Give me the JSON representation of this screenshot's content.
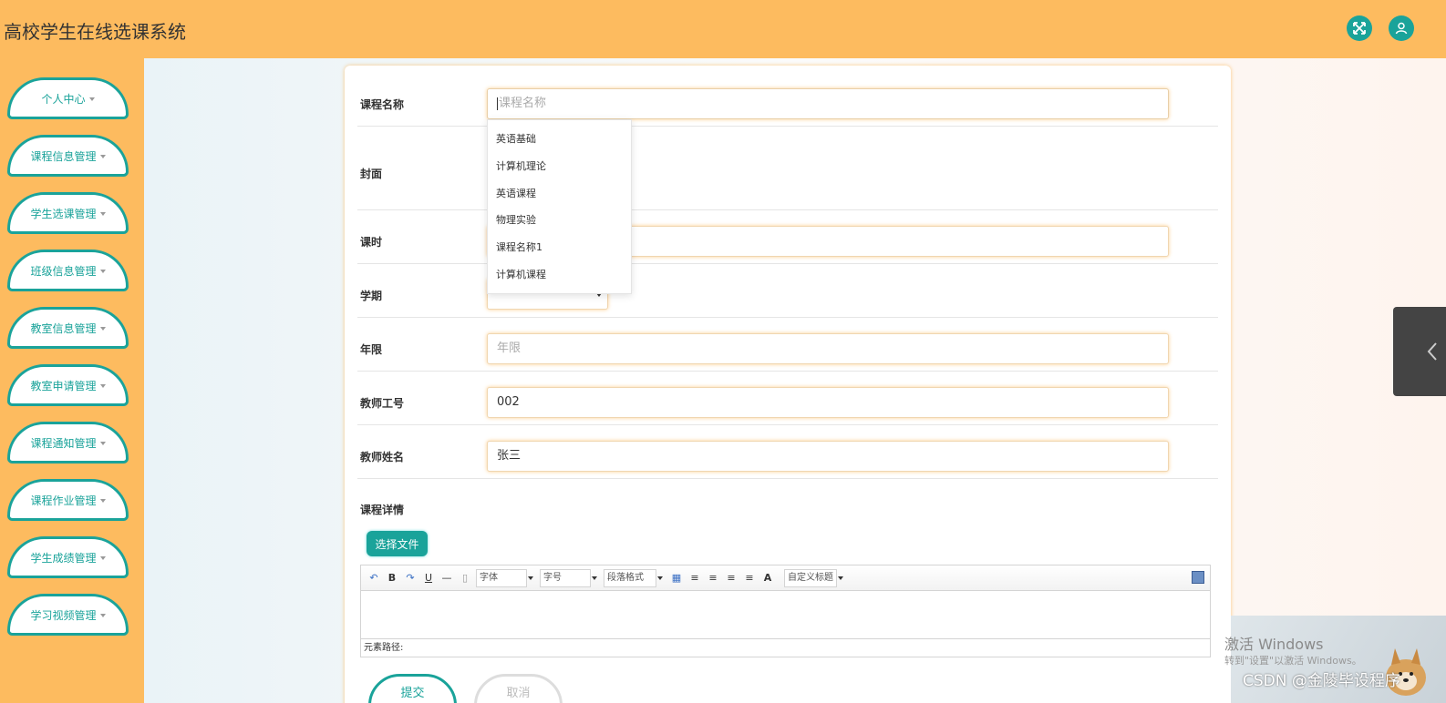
{
  "app": {
    "title": "高校学生在线选课系统"
  },
  "topbar": {
    "icons": [
      "fullscreen-icon",
      "user-icon"
    ]
  },
  "sidebar": {
    "items": [
      {
        "label": "个人中心"
      },
      {
        "label": "课程信息管理"
      },
      {
        "label": "学生选课管理"
      },
      {
        "label": "班级信息管理"
      },
      {
        "label": "教室信息管理"
      },
      {
        "label": "教室申请管理"
      },
      {
        "label": "课程通知管理"
      },
      {
        "label": "课程作业管理"
      },
      {
        "label": "学生成绩管理"
      },
      {
        "label": "学习视频管理"
      }
    ]
  },
  "form": {
    "course_name": {
      "label": "课程名称",
      "placeholder": "课程名称",
      "value": ""
    },
    "cover": {
      "label": "封面"
    },
    "hours": {
      "label": "课时",
      "value": ""
    },
    "term": {
      "label": "学期",
      "value": ""
    },
    "years": {
      "label": "年限",
      "placeholder": "年限",
      "value": ""
    },
    "teacher_id": {
      "label": "教师工号",
      "value": "002"
    },
    "teacher_name": {
      "label": "教师姓名",
      "value": "张三"
    },
    "details": {
      "label": "课程详情"
    },
    "file_button": "选择文件",
    "submit": "提交",
    "cancel": "取消"
  },
  "autocomplete": {
    "options": [
      "英语基础",
      "计算机理论",
      "英语课程",
      "物理实验",
      "课程名称1",
      "计算机课程"
    ]
  },
  "editor": {
    "font_select": "字体",
    "size_select": "字号",
    "paragraph_select": "段落格式",
    "font_color_glyph": "A",
    "custom_title_select": "自定义标题",
    "path_label": "元素路径:"
  },
  "watermark": {
    "title": "激活 Windows",
    "subtitle": "转到\"设置\"以激活 Windows。",
    "csdn": "CSDN @金陵毕设程序"
  },
  "colors": {
    "accent": "#1aa39a",
    "header": "#fdbb5f"
  }
}
